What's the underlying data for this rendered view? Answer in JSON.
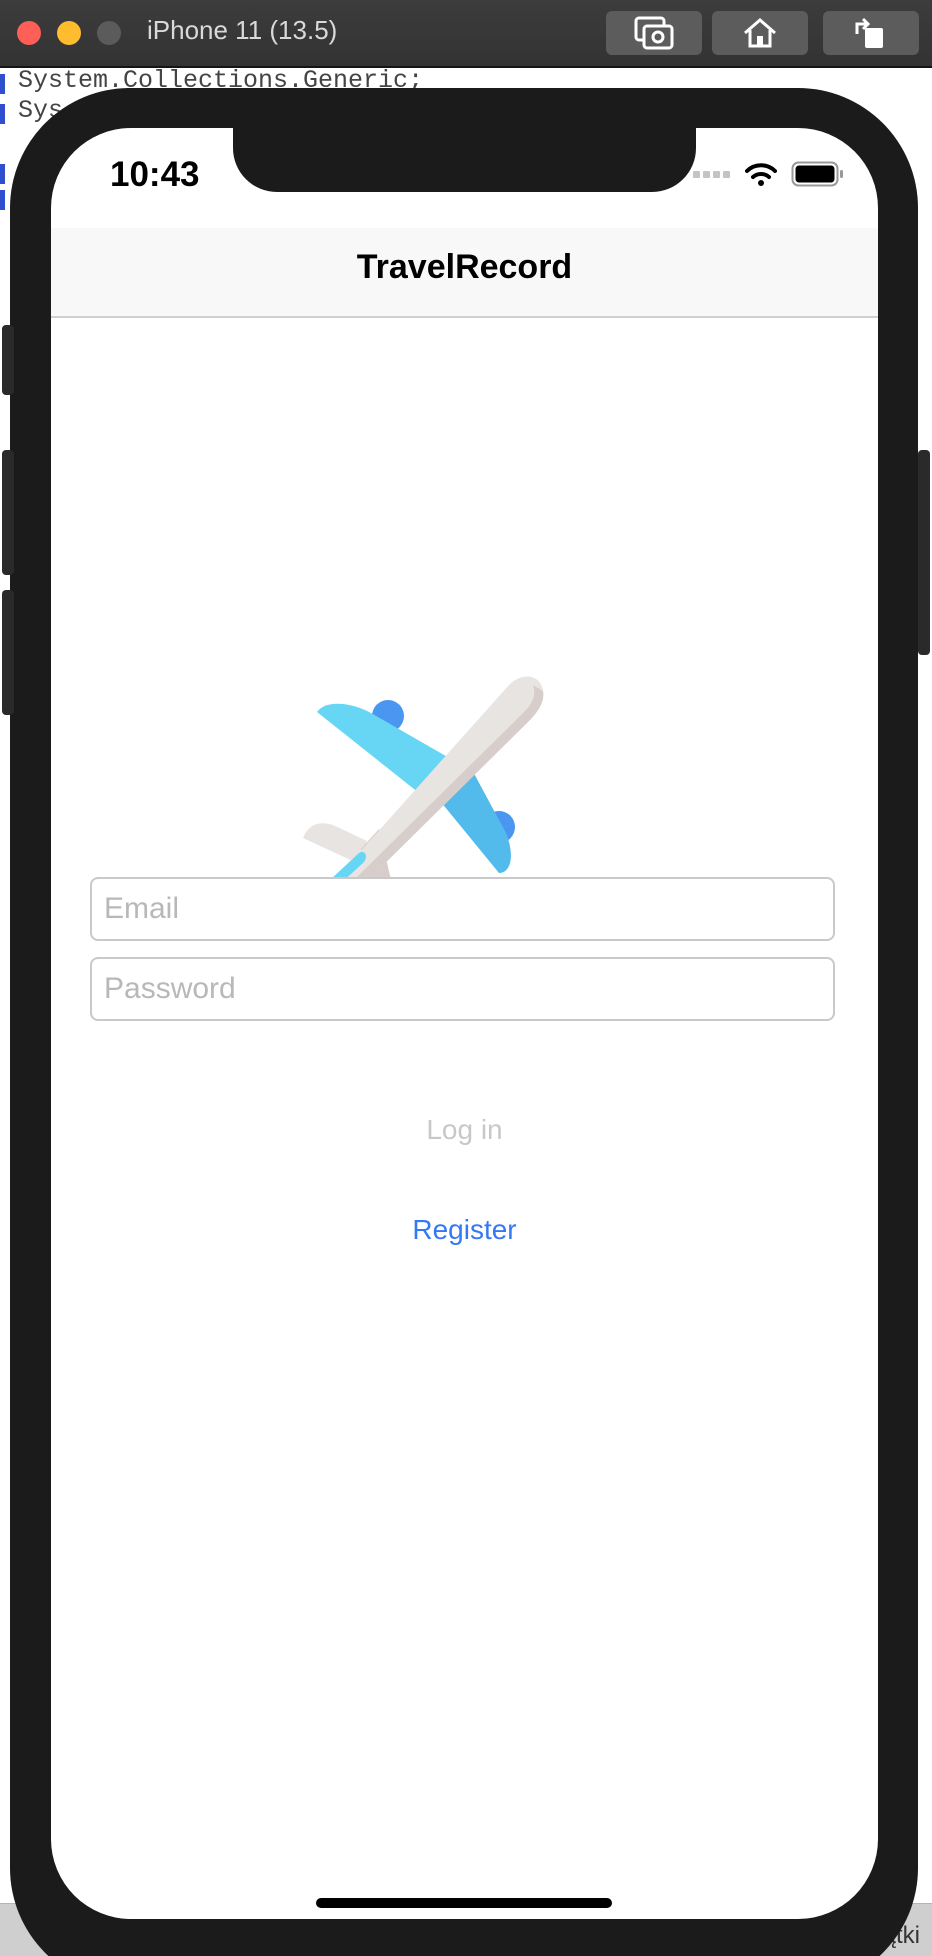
{
  "window": {
    "title": "iPhone 11 (13.5)",
    "buttons": [
      {
        "icon": "screenshot-icon"
      },
      {
        "icon": "home-icon"
      },
      {
        "icon": "rotate-icon"
      }
    ]
  },
  "code_background": {
    "line1": "System.Collections.Generic;",
    "line2": "Sys",
    "bottom_right": "Wątki"
  },
  "status_bar": {
    "time": "10:43",
    "icons": [
      "signal-icon",
      "wifi-icon",
      "battery-icon"
    ]
  },
  "nav": {
    "title": "TravelRecord"
  },
  "login": {
    "logo_icon": "airplane-icon",
    "email_placeholder": "Email",
    "password_placeholder": "Password",
    "login_label": "Log in",
    "register_label": "Register"
  },
  "colors": {
    "register_blue": "#3478f6",
    "login_disabled": "#c8c8c8",
    "plane_wing": "#5ecbf0",
    "plane_body": "#e8e4e2",
    "plane_engine": "#4a97f1"
  }
}
